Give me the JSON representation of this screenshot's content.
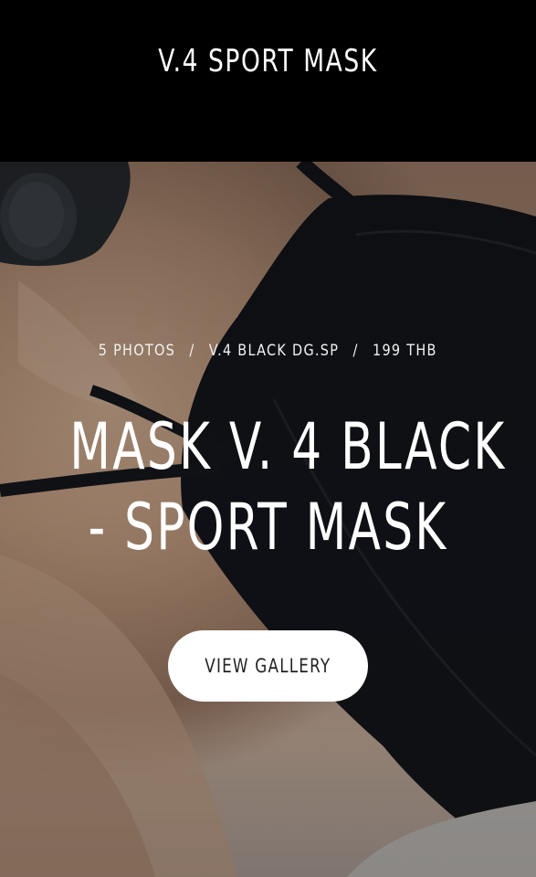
{
  "header": {
    "title": "V.4 SPORT MASK"
  },
  "hero": {
    "meta": {
      "photos": "5 PHOTOS",
      "separator": "/",
      "sku": "V.4 BLACK DG.SP",
      "price": "199 THB"
    },
    "title_line1": "MASK V. 4 BLACK",
    "title_line2": "- SPORT MASK",
    "cta_label": "VIEW GALLERY",
    "image_subject": "black-sport-mask-photo"
  },
  "colors": {
    "header_bg": "#000000",
    "mask": "#14161c",
    "button_bg": "#ffffff",
    "button_text": "#222222",
    "text": "#ffffff"
  }
}
